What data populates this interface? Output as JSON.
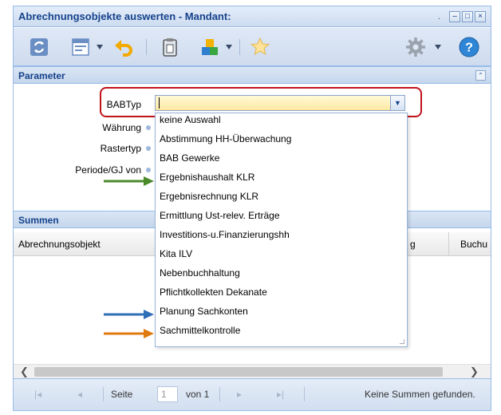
{
  "window": {
    "title": "Abrechnungsobjekte auswerten - Mandant:",
    "title_dot": ".",
    "controls": {
      "minimize": "–",
      "maximize": "□",
      "close": "×"
    }
  },
  "toolbar": {
    "icons": [
      "refresh-icon",
      "layout-icon",
      "undo-icon",
      "clipboard-icon",
      "cubes-icon",
      "favorite-star-icon",
      "settings-gear-icon",
      "help-icon"
    ]
  },
  "parameter": {
    "header": "Parameter",
    "collapse_glyph": "⌃",
    "fields": {
      "babtyp": {
        "label": "BABTyp",
        "value": ""
      },
      "waehrung": {
        "label": "Währung"
      },
      "rastertyp": {
        "label": "Rastertyp"
      },
      "periode": {
        "label": "Periode/GJ von"
      }
    },
    "dropdown_options": [
      "keine Auswahl",
      "Abstimmung HH-Überwachung",
      "BAB Gewerke",
      "Ergebnishaushalt KLR",
      "Ergebnisrechnung KLR",
      "Ermittlung Ust-relev. Erträge",
      "Investitions-u.Finanzierungshh",
      "Kita ILV",
      "Nebenbuchhaltung",
      "Pflichtkollekten Dekanate",
      "Planung Sachkonten",
      "Sachmittelkontrolle"
    ]
  },
  "summen": {
    "header": "Summen",
    "columns": [
      "Abrechnungsobjekt",
      "g",
      "Buchu"
    ]
  },
  "pager": {
    "page_label": "Seite",
    "page_value": "1",
    "of_label": "von 1",
    "status": "Keine Summen gefunden."
  },
  "annotation_colors": {
    "green": "#4a8a2a",
    "blue": "#2f6fb7",
    "orange": "#e07a10",
    "highlight": "#c0141c"
  }
}
